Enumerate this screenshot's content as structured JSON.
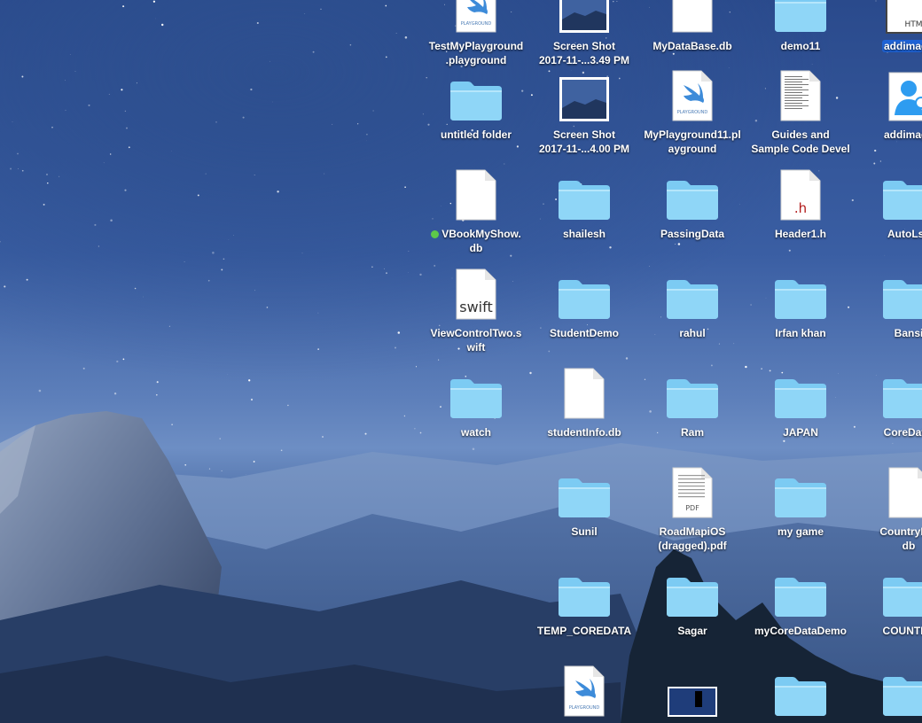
{
  "desktop": {
    "icons": [
      {
        "label": "TestMyPlayground\n.playground",
        "type": "playground"
      },
      {
        "label": "Screen Shot\n2017-11-...3.49 PM",
        "type": "screenshot"
      },
      {
        "label": "MyDataBase.db",
        "type": "file"
      },
      {
        "label": "demo11",
        "type": "folder"
      },
      {
        "label": "addimage",
        "type": "html",
        "selected": true
      },
      {
        "label": "untitled folder",
        "type": "folder"
      },
      {
        "label": "Screen Shot\n2017-11-...4.00 PM",
        "type": "screenshot"
      },
      {
        "label": "MyPlayground11.pl\nayground",
        "type": "playground"
      },
      {
        "label": "Guides and\nSample Code Devel",
        "type": "document"
      },
      {
        "label": "addimage",
        "type": "contact"
      },
      {
        "label": "VBookMyShow.\ndb",
        "type": "file",
        "tag": "green"
      },
      {
        "label": "shailesh",
        "type": "folder"
      },
      {
        "label": "PassingData",
        "type": "folder"
      },
      {
        "label": "Header1.h",
        "type": "header"
      },
      {
        "label": "AutoLsy",
        "type": "folder"
      },
      {
        "label": "ViewControlTwo.s\nwift",
        "type": "swift"
      },
      {
        "label": "StudentDemo",
        "type": "folder"
      },
      {
        "label": "rahul",
        "type": "folder"
      },
      {
        "label": "Irfan khan",
        "type": "folder"
      },
      {
        "label": "Bansi",
        "type": "folder"
      },
      {
        "label": "watch",
        "type": "folder"
      },
      {
        "label": "studentInfo.db",
        "type": "file"
      },
      {
        "label": "Ram",
        "type": "folder"
      },
      {
        "label": "JAPAN",
        "type": "folder"
      },
      {
        "label": "CoreDatal",
        "type": "folder"
      },
      {
        "label": "Sunil",
        "type": "folder"
      },
      {
        "label": "RoadMapiOS\n(dragged).pdf",
        "type": "pdf"
      },
      {
        "label": "my game",
        "type": "folder"
      },
      {
        "label": "CountryDat\ndb",
        "type": "file"
      },
      {
        "label": "TEMP_COREDATA",
        "type": "folder"
      },
      {
        "label": "Sagar",
        "type": "folder"
      },
      {
        "label": "myCoreDataDemo",
        "type": "folder"
      },
      {
        "label": "COUNTRY",
        "type": "folder"
      },
      {
        "label": "",
        "type": "playground"
      },
      {
        "label": "",
        "type": "screenshot-dark"
      },
      {
        "label": "",
        "type": "folder"
      },
      {
        "label": "",
        "type": "folder"
      }
    ],
    "badges": {
      "playground": "PLAYGROUND",
      "pdf": "PDF",
      "swift": "swift",
      "header": ".h",
      "html": "HTML"
    },
    "colors": {
      "folder": "#7ccbf3",
      "selection": "#1f63d6",
      "tag_green": "#5dc84a"
    }
  }
}
